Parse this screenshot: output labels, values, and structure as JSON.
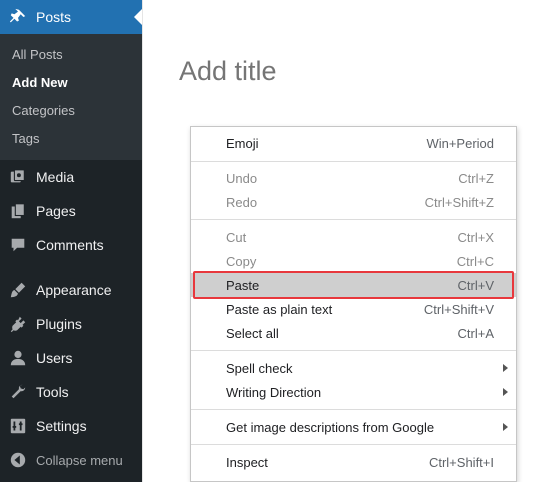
{
  "sidebar": {
    "posts": "Posts",
    "submenu": [
      "All Posts",
      "Add New",
      "Categories",
      "Tags"
    ],
    "items": [
      {
        "label": "Media",
        "icon": "media-icon"
      },
      {
        "label": "Pages",
        "icon": "pages-icon"
      },
      {
        "label": "Comments",
        "icon": "comments-icon"
      },
      {
        "label": "Appearance",
        "icon": "appearance-icon"
      },
      {
        "label": "Plugins",
        "icon": "plugins-icon"
      },
      {
        "label": "Users",
        "icon": "users-icon"
      },
      {
        "label": "Tools",
        "icon": "tools-icon"
      },
      {
        "label": "Settings",
        "icon": "settings-icon"
      }
    ],
    "collapse": "Collapse menu"
  },
  "editor": {
    "title_placeholder": "Add title"
  },
  "context_menu": {
    "items": [
      {
        "label": "Emoji",
        "shortcut": "Win+Period"
      },
      {
        "label": "Undo",
        "shortcut": "Ctrl+Z"
      },
      {
        "label": "Redo",
        "shortcut": "Ctrl+Shift+Z"
      },
      {
        "label": "Cut",
        "shortcut": "Ctrl+X"
      },
      {
        "label": "Copy",
        "shortcut": "Ctrl+C"
      },
      {
        "label": "Paste",
        "shortcut": "Ctrl+V"
      },
      {
        "label": "Paste as plain text",
        "shortcut": "Ctrl+Shift+V"
      },
      {
        "label": "Select all",
        "shortcut": "Ctrl+A"
      },
      {
        "label": "Spell check",
        "shortcut": ""
      },
      {
        "label": "Writing Direction",
        "shortcut": ""
      },
      {
        "label": "Get image descriptions from Google",
        "shortcut": ""
      },
      {
        "label": "Inspect",
        "shortcut": "Ctrl+Shift+I"
      }
    ]
  },
  "colors": {
    "sidebar_bg": "#1d2327",
    "submenu_bg": "#2c3338",
    "active_bg": "#2271b1",
    "highlight_border": "#e8383d"
  }
}
